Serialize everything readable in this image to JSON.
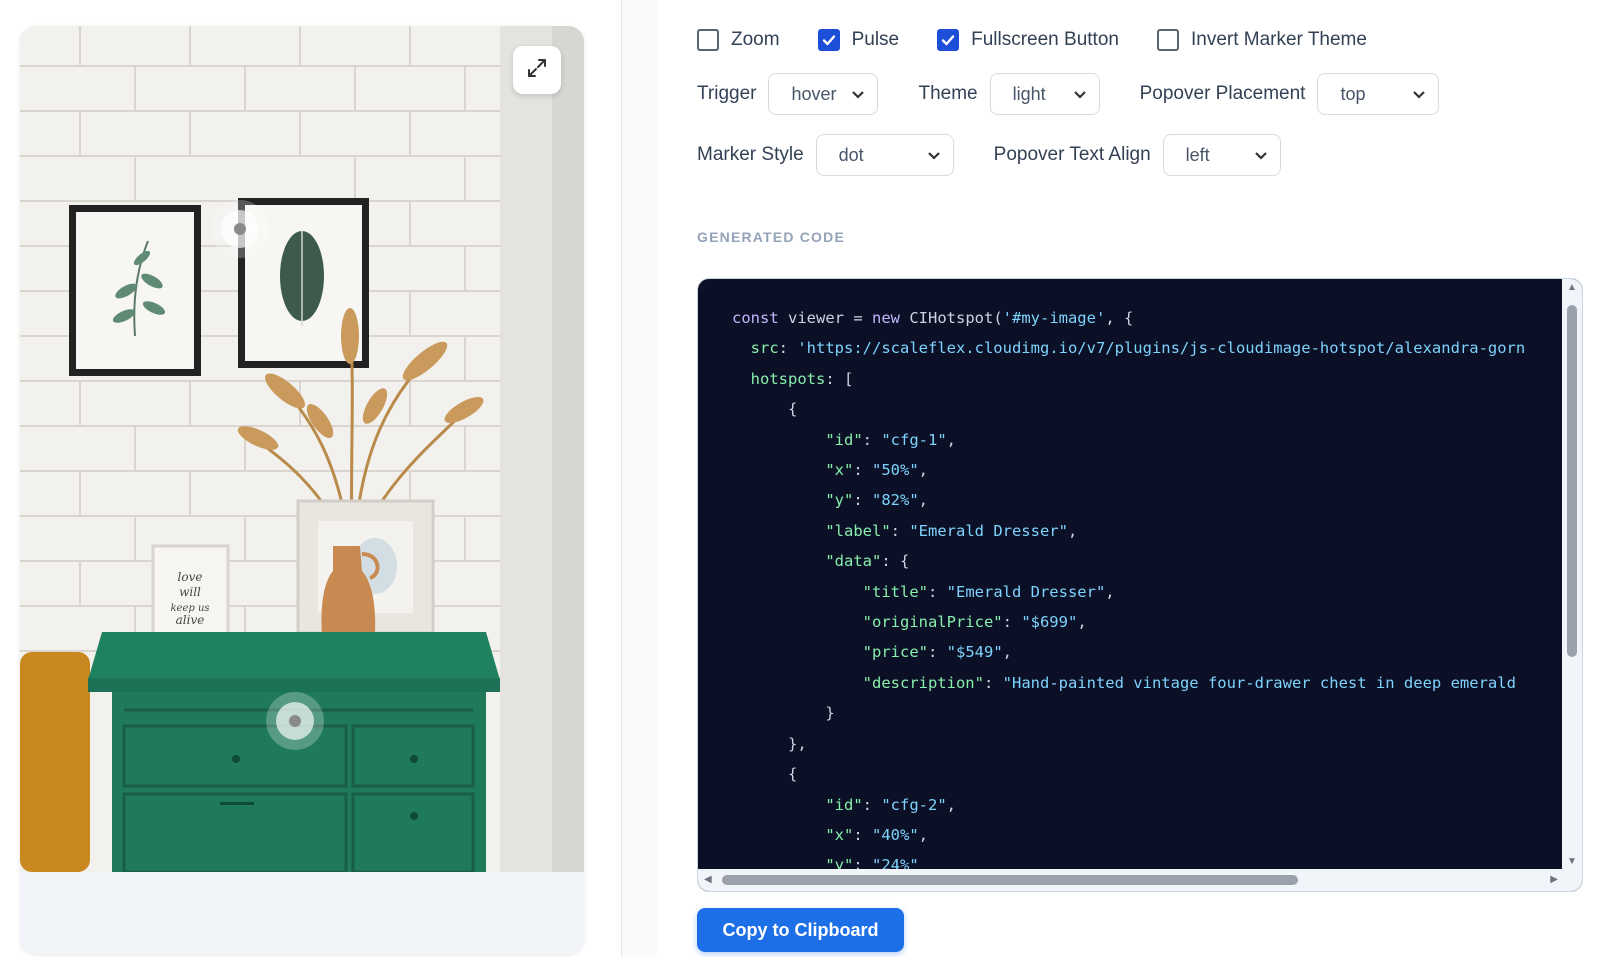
{
  "image": {
    "fullscreen_icon": "expand-icon",
    "hotspots": [
      {
        "id": "hotspot-upper"
      },
      {
        "id": "hotspot-dresser"
      }
    ]
  },
  "options": {
    "checkboxes": [
      {
        "label": "Zoom",
        "checked": false
      },
      {
        "label": "Pulse",
        "checked": true
      },
      {
        "label": "Fullscreen Button",
        "checked": true
      },
      {
        "label": "Invert Marker Theme",
        "checked": false
      }
    ],
    "trigger": {
      "label": "Trigger",
      "value": "hover"
    },
    "theme": {
      "label": "Theme",
      "value": "light"
    },
    "placement": {
      "label": "Popover Placement",
      "value": "top"
    },
    "marker_style": {
      "label": "Marker Style",
      "value": "dot"
    },
    "text_align": {
      "label": "Popover Text Align",
      "value": "left"
    }
  },
  "code_section": {
    "title": "GENERATED CODE",
    "lines": [
      [
        [
          "kw",
          "const"
        ],
        [
          "pl",
          " viewer = "
        ],
        [
          "kw",
          "new"
        ],
        [
          "pl",
          " CIHotspot("
        ],
        [
          "str",
          "'#my-image'"
        ],
        [
          "pl",
          ", {"
        ]
      ],
      [
        [
          "pl",
          "  "
        ],
        [
          "key",
          "src"
        ],
        [
          "pl",
          ": "
        ],
        [
          "str",
          "'https://scaleflex.cloudimg.io/v7/plugins/js-cloudimage-hotspot/alexandra-gorn"
        ]
      ],
      [
        [
          "pl",
          "  "
        ],
        [
          "key",
          "hotspots"
        ],
        [
          "pl",
          ": ["
        ]
      ],
      [
        [
          "pl",
          "      {"
        ]
      ],
      [
        [
          "pl",
          "          "
        ],
        [
          "key",
          "\"id\""
        ],
        [
          "pl",
          ": "
        ],
        [
          "str",
          "\"cfg-1\""
        ],
        [
          "pl",
          ","
        ]
      ],
      [
        [
          "pl",
          "          "
        ],
        [
          "key",
          "\"x\""
        ],
        [
          "pl",
          ": "
        ],
        [
          "str",
          "\"50%\""
        ],
        [
          "pl",
          ","
        ]
      ],
      [
        [
          "pl",
          "          "
        ],
        [
          "key",
          "\"y\""
        ],
        [
          "pl",
          ": "
        ],
        [
          "str",
          "\"82%\""
        ],
        [
          "pl",
          ","
        ]
      ],
      [
        [
          "pl",
          "          "
        ],
        [
          "key",
          "\"label\""
        ],
        [
          "pl",
          ": "
        ],
        [
          "str",
          "\"Emerald Dresser\""
        ],
        [
          "pl",
          ","
        ]
      ],
      [
        [
          "pl",
          "          "
        ],
        [
          "key",
          "\"data\""
        ],
        [
          "pl",
          ": {"
        ]
      ],
      [
        [
          "pl",
          "              "
        ],
        [
          "key",
          "\"title\""
        ],
        [
          "pl",
          ": "
        ],
        [
          "str",
          "\"Emerald Dresser\""
        ],
        [
          "pl",
          ","
        ]
      ],
      [
        [
          "pl",
          "              "
        ],
        [
          "key",
          "\"originalPrice\""
        ],
        [
          "pl",
          ": "
        ],
        [
          "str",
          "\"$699\""
        ],
        [
          "pl",
          ","
        ]
      ],
      [
        [
          "pl",
          "              "
        ],
        [
          "key",
          "\"price\""
        ],
        [
          "pl",
          ": "
        ],
        [
          "str",
          "\"$549\""
        ],
        [
          "pl",
          ","
        ]
      ],
      [
        [
          "pl",
          "              "
        ],
        [
          "key",
          "\"description\""
        ],
        [
          "pl",
          ": "
        ],
        [
          "str",
          "\"Hand-painted vintage four-drawer chest in deep emerald"
        ]
      ],
      [
        [
          "pl",
          "          }"
        ]
      ],
      [
        [
          "pl",
          "      },"
        ]
      ],
      [
        [
          "pl",
          "      {"
        ]
      ],
      [
        [
          "pl",
          "          "
        ],
        [
          "key",
          "\"id\""
        ],
        [
          "pl",
          ": "
        ],
        [
          "str",
          "\"cfg-2\""
        ],
        [
          "pl",
          ","
        ]
      ],
      [
        [
          "pl",
          "          "
        ],
        [
          "key",
          "\"x\""
        ],
        [
          "pl",
          ": "
        ],
        [
          "str",
          "\"40%\""
        ],
        [
          "pl",
          ","
        ]
      ],
      [
        [
          "pl",
          "          "
        ],
        [
          "key",
          "\"y\""
        ],
        [
          "pl",
          ": "
        ],
        [
          "str",
          "\"24%\""
        ]
      ]
    ]
  },
  "copy_button": {
    "label": "Copy to Clipboard"
  },
  "colors": {
    "accent": "#1d6fe8",
    "code_bg": "#0b1026",
    "dresser": "#1f7a5a"
  }
}
